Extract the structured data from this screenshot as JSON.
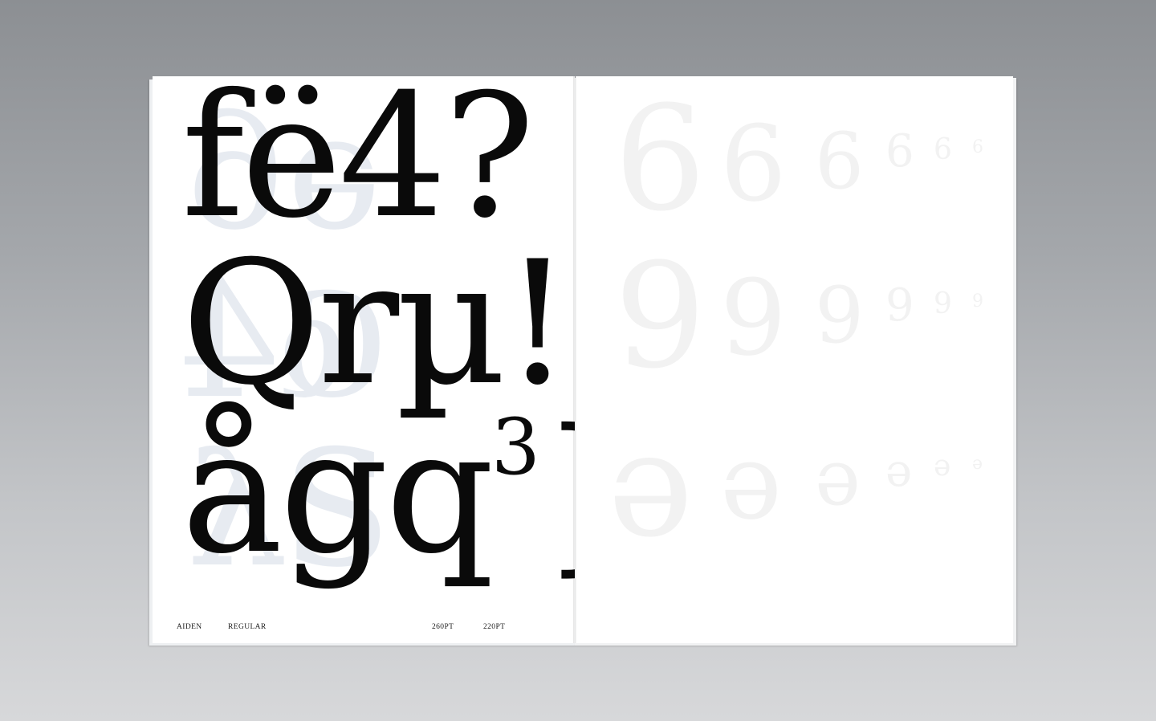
{
  "left_page": {
    "lines": [
      {
        "text": "fë4?"
      },
      {
        "text": "Qrµ!"
      },
      {
        "text": "ågq",
        "superscript": "3",
        "suffix": "}"
      }
    ],
    "footer": {
      "name": "AIDEN",
      "style": "REGULAR",
      "size_a": "260PT",
      "size_b": "220PT"
    }
  },
  "right_page": {
    "rows": [
      {
        "glyph": "6"
      },
      {
        "glyph": "9"
      },
      {
        "glyph": "ə"
      }
    ]
  },
  "colors": {
    "background_top": "#8c8f93",
    "background_bottom": "#d7d8da",
    "paper": "#ffffff",
    "ink": "#0a0a0a",
    "show_through": "#e7ebf1"
  }
}
